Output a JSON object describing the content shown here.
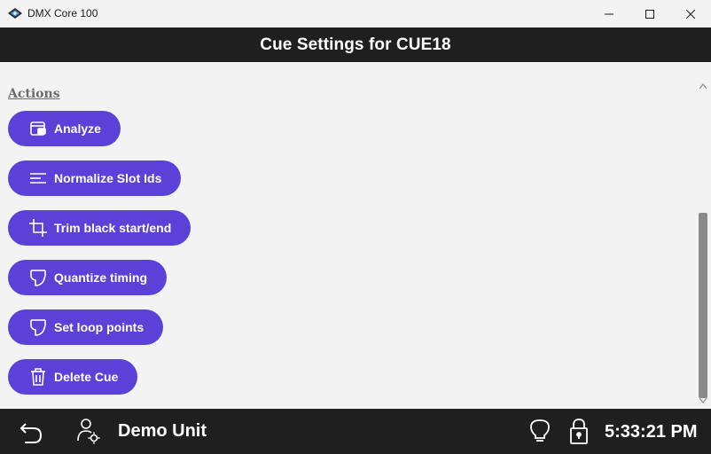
{
  "window": {
    "title": "DMX Core 100"
  },
  "header": {
    "title": "Cue Settings for CUE18"
  },
  "actions": {
    "heading": "Actions",
    "items": [
      {
        "label": "Analyze",
        "icon": "analyze-icon"
      },
      {
        "label": "Normalize Slot Ids",
        "icon": "normalize-lines-icon"
      },
      {
        "label": "Trim black start/end",
        "icon": "crop-icon"
      },
      {
        "label": "Quantize timing",
        "icon": "quantize-icon"
      },
      {
        "label": "Set loop points",
        "icon": "loop-points-icon"
      },
      {
        "label": "Delete Cue",
        "icon": "trash-icon"
      }
    ]
  },
  "footer": {
    "unit_name": "Demo Unit",
    "time": "5:33:21 PM"
  },
  "colors": {
    "accent": "#5b41d8",
    "bar": "#1f1f1f",
    "background": "#f3f3f3"
  }
}
